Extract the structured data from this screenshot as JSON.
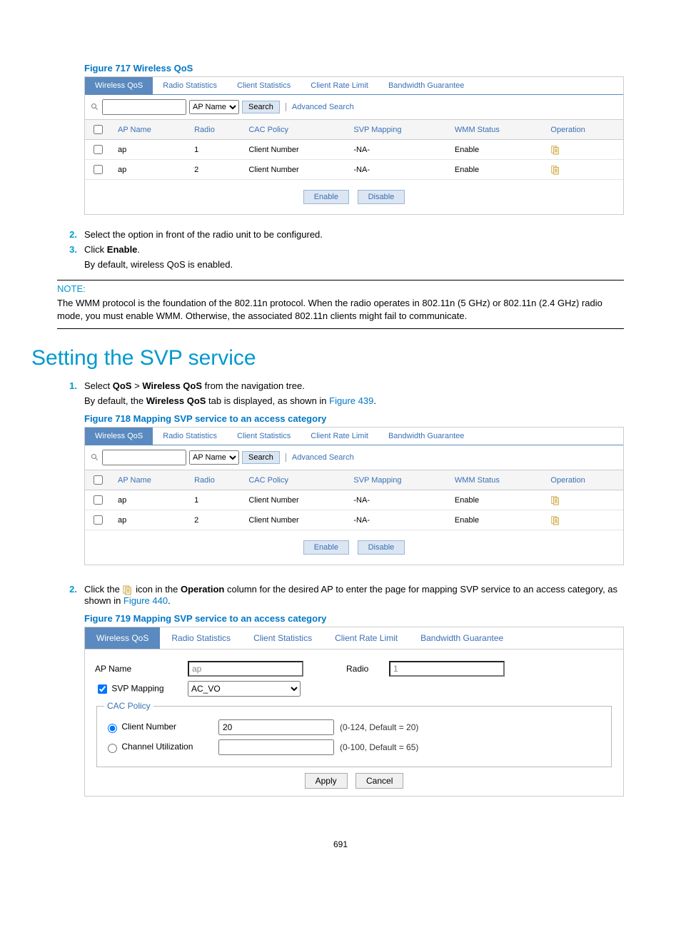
{
  "figure717": {
    "caption": "Figure 717 Wireless QoS",
    "tabs": [
      "Wireless QoS",
      "Radio Statistics",
      "Client Statistics",
      "Client Rate Limit",
      "Bandwidth Guarantee"
    ],
    "active_tab": 0,
    "search_dropdown": "AP Name",
    "search_button": "Search",
    "adv_search": "Advanced Search",
    "headers": [
      "AP Name",
      "Radio",
      "CAC Policy",
      "SVP Mapping",
      "WMM Status",
      "Operation"
    ],
    "rows": [
      {
        "ap": "ap",
        "radio": "1",
        "cac": "Client Number",
        "svp": "-NA-",
        "wmm": "Enable"
      },
      {
        "ap": "ap",
        "radio": "2",
        "cac": "Client Number",
        "svp": "-NA-",
        "wmm": "Enable"
      }
    ],
    "enable_btn": "Enable",
    "disable_btn": "Disable"
  },
  "step2": "Select the option in front of the radio unit to be configured.",
  "step3_prefix": "Click ",
  "step3_bold": "Enable",
  "step3_suffix": ".",
  "step3_after": "By default, wireless QoS is enabled.",
  "note_label": "NOTE:",
  "note_text": "The WMM protocol is the foundation of the 802.11n protocol. When the radio operates in 802.11n (5 GHz) or 802.11n (2.4 GHz) radio mode, you must enable WMM. Otherwise, the associated 802.11n clients might fail to communicate.",
  "h1": "Setting the SVP service",
  "sec2_step1_a": "Select ",
  "sec2_step1_b": "QoS",
  "sec2_step1_c": " > ",
  "sec2_step1_d": "Wireless QoS",
  "sec2_step1_e": " from the navigation tree.",
  "sec2_step1_after_a": "By default, the ",
  "sec2_step1_after_b": "Wireless QoS",
  "sec2_step1_after_c": " tab is displayed, as shown in ",
  "sec2_step1_link": "Figure 439",
  "sec2_step1_after_d": ".",
  "figure718": {
    "caption": "Figure 718 Mapping SVP service to an access category",
    "tabs": [
      "Wireless QoS",
      "Radio Statistics",
      "Client Statistics",
      "Client Rate Limit",
      "Bandwidth Guarantee"
    ],
    "active_tab": 0,
    "search_dropdown": "AP Name",
    "search_button": "Search",
    "adv_search": "Advanced Search",
    "headers": [
      "AP Name",
      "Radio",
      "CAC Policy",
      "SVP Mapping",
      "WMM Status",
      "Operation"
    ],
    "rows": [
      {
        "ap": "ap",
        "radio": "1",
        "cac": "Client Number",
        "svp": "-NA-",
        "wmm": "Enable"
      },
      {
        "ap": "ap",
        "radio": "2",
        "cac": "Client Number",
        "svp": "-NA-",
        "wmm": "Enable"
      }
    ],
    "enable_btn": "Enable",
    "disable_btn": "Disable"
  },
  "sec2_step2_a": "Click the ",
  "sec2_step2_b": " icon in the ",
  "sec2_step2_c": "Operation",
  "sec2_step2_d": " column for the desired AP to enter the page for mapping SVP service to an access category, as shown in ",
  "sec2_step2_link": "Figure 440",
  "sec2_step2_e": ".",
  "figure719": {
    "caption": "Figure 719 Mapping SVP service to an access category",
    "tabs": [
      "Wireless QoS",
      "Radio Statistics",
      "Client Statistics",
      "Client Rate Limit",
      "Bandwidth Guarantee"
    ],
    "active_tab": 0,
    "ap_name_label": "AP Name",
    "ap_name_value": "ap",
    "radio_label": "Radio",
    "radio_value": "1",
    "svp_label": "SVP Mapping",
    "svp_value": "AC_VO",
    "cac_legend": "CAC Policy",
    "client_number_label": "Client Number",
    "client_number_value": "20",
    "client_number_hint": "(0-124, Default = 20)",
    "channel_util_label": "Channel Utilization",
    "channel_util_value": "",
    "channel_util_hint": "(0-100, Default = 65)",
    "apply_btn": "Apply",
    "cancel_btn": "Cancel"
  },
  "page_number": "691"
}
